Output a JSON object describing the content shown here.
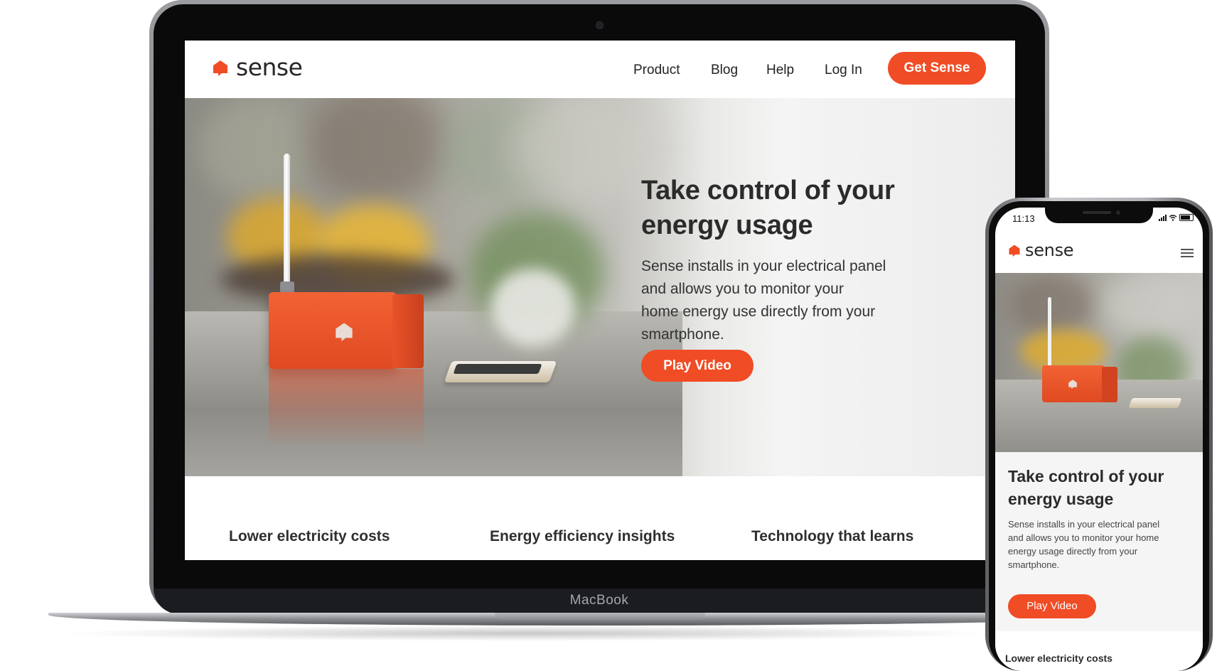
{
  "colors": {
    "brand": "#f04c25",
    "text_dark": "#2b2b2b"
  },
  "laptop": {
    "brand_label": "MacBook",
    "site": {
      "logo_text": "sense",
      "nav": {
        "links": [
          {
            "label": "Product"
          },
          {
            "label": "Blog"
          },
          {
            "label": "Help"
          },
          {
            "label": "Log In"
          }
        ],
        "cta_label": "Get Sense"
      },
      "hero": {
        "title_line1": "Take control of your",
        "title_line2": "energy usage",
        "body_line1": "Sense installs in your electrical panel",
        "body_line2": "and allows you to monitor your",
        "body_line3": "home energy use directly from your",
        "body_line4": "smartphone.",
        "play_label": "Play Video"
      },
      "features": [
        {
          "title": "Lower electricity costs"
        },
        {
          "title": "Energy efficiency insights"
        },
        {
          "title": "Technology that learns"
        }
      ]
    }
  },
  "phone": {
    "status_time": "11:13",
    "logo_text": "sense",
    "menu_icon": "hamburger-icon",
    "hero": {
      "title_line1": "Take control of your",
      "title_line2": "energy usage",
      "body_line1": "Sense installs in your electrical panel",
      "body_line2": "and allows you to monitor your home",
      "body_line3": "energy usage directly from your",
      "body_line4": "smartphone.",
      "play_label": "Play Video"
    },
    "next_section_title": "Lower electricity costs"
  }
}
